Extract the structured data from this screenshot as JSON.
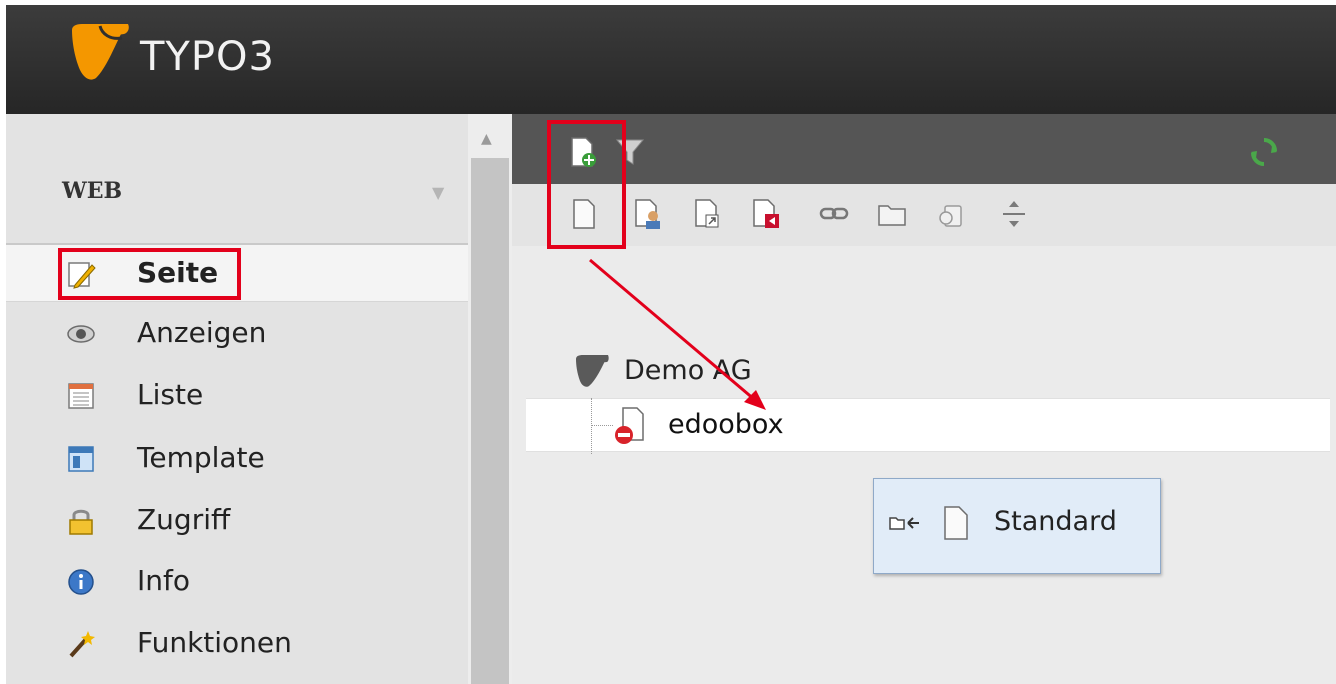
{
  "header": {
    "brand": "TYPO3",
    "logo_icon": "typo3-logo-icon",
    "brand_color": "#f49700"
  },
  "module_menu": {
    "section": "WEB",
    "items": [
      {
        "label": "Seite",
        "icon": "page-edit-icon",
        "active": true
      },
      {
        "label": "Anzeigen",
        "icon": "eye-icon",
        "active": false
      },
      {
        "label": "Liste",
        "icon": "list-icon",
        "active": false
      },
      {
        "label": "Template",
        "icon": "template-icon",
        "active": false
      },
      {
        "label": "Zugriff",
        "icon": "lock-icon",
        "active": false
      },
      {
        "label": "Info",
        "icon": "info-icon",
        "active": false
      },
      {
        "label": "Funktionen",
        "icon": "wand-icon",
        "active": false
      }
    ]
  },
  "page_tree": {
    "root": {
      "label": "Demo AG",
      "icon": "typo3-root-icon"
    },
    "nodes": [
      {
        "label": "edoobox",
        "icon": "page-hidden-icon"
      }
    ]
  },
  "drag_tooltip": {
    "label": "Standard",
    "icon": "page-icon",
    "action_icon": "insert-into-icon"
  },
  "highlight_color": "#e3001b"
}
